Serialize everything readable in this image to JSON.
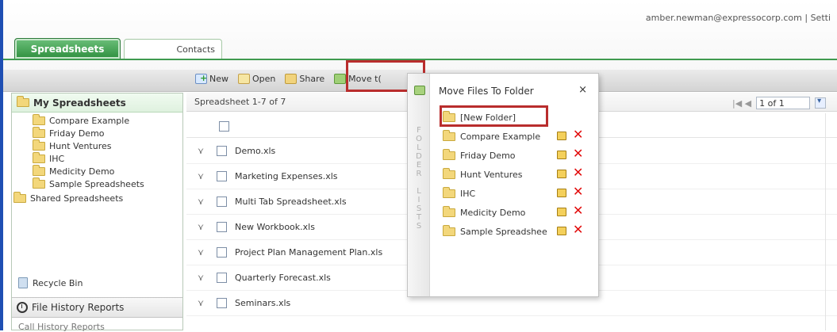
{
  "header": {
    "user_info": "amber.newman@expressocorp.com | Setti"
  },
  "tabs": [
    {
      "label": "Spreadsheets"
    },
    {
      "label": "Contacts"
    }
  ],
  "toolbar": {
    "new_label": "New",
    "open_label": "Open",
    "share_label": "Share",
    "move_label": "Move t("
  },
  "left_panel": {
    "root_label": "My Spreadsheets",
    "folders": [
      "Compare Example",
      "Friday Demo",
      "Hunt Ventures",
      "IHC",
      "Medicity Demo",
      "Sample Spreadsheets"
    ],
    "shared_label": "Shared Spreadsheets",
    "recycle_label": "Recycle Bin",
    "history_label": "File History Reports",
    "cut_label": "Call History Reports"
  },
  "grid": {
    "range_label": "Spreadsheet 1-7 of 7",
    "pager": {
      "page_value": "1 of 1",
      "arrows": "|◀ ◀"
    },
    "files": [
      "Demo.xls",
      "Marketing Expenses.xls",
      "Multi Tab Spreadsheet.xls",
      "New Workbook.xls",
      "Project Plan Management Plan.xls",
      "Quarterly Forecast.xls",
      "Seminars.xls"
    ]
  },
  "popup": {
    "title": "Move Files To Folder",
    "close": "×",
    "vertical_label": "F\nO\nL\nD\nE\nR\n\nL\nI\nS\nT\nS",
    "new_folder": "[New Folder]",
    "folders": [
      "Compare Example",
      "Friday Demo",
      "Hunt Ventures",
      "IHC",
      "Medicity Demo",
      "Sample Spreadshee"
    ],
    "delete_icon": "✕"
  },
  "icons": {
    "new": "new-file-icon",
    "open": "open-file-icon",
    "share": "share-folder-icon",
    "move": "move-folder-icon",
    "folder": "folder-icon",
    "recycle": "recycle-bin-icon",
    "history": "clock-icon",
    "edit": "edit-icon",
    "delete": "delete-icon"
  }
}
